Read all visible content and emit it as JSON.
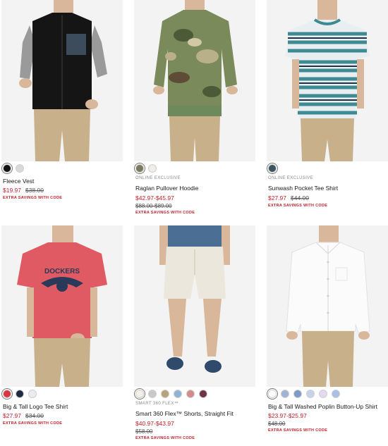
{
  "products": [
    {
      "name": "Fleece Vest",
      "tag": "",
      "sale_price": "$19.97",
      "original_price": "$38.00",
      "promo": "EXTRA SAVINGS WITH CODE",
      "swatches": [
        "#111111",
        "#d9d9d9"
      ]
    },
    {
      "name": "Raglan Pullover Hoodie",
      "tag": "ONLINE EXCLUSIVE",
      "sale_price": "$42.97-$45.97",
      "original_price": "$88.00-$89.00",
      "promo": "EXTRA SAVINGS WITH CODE",
      "swatches": [
        "#7c7a5c",
        "#f0ece6"
      ]
    },
    {
      "name": "Sunwash Pocket Tee Shirt",
      "tag": "ONLINE EXCLUSIVE",
      "sale_price": "$27.97",
      "original_price": "$44.00",
      "promo": "EXTRA SAVINGS WITH CODE",
      "swatches": [
        "#3b5560"
      ]
    },
    {
      "name": "Big & Tall Logo Tee Shirt",
      "tag": "",
      "sale_price": "$27.97",
      "original_price": "$34.00",
      "promo": "EXTRA SAVINGS WITH CODE",
      "swatches": [
        "#d9373d",
        "#1f2b45",
        "#e9edf2"
      ]
    },
    {
      "name": "Smart 360 Flex™ Shorts, Straight Fit",
      "tag": "SMART 360 FLEX™",
      "sale_price": "$40.97-$43.97",
      "original_price": "$58.00",
      "promo": "EXTRA SAVINGS WITH CODE",
      "swatches": [
        "#f5efe6",
        "#c9c9c9",
        "#b7a27c",
        "#8fb3d6",
        "#d38c8c",
        "#6e3344"
      ]
    },
    {
      "name": "Big & Tall Washed Poplin Button-Up Shirt",
      "tag": "",
      "sale_price": "$23.97-$25.97",
      "original_price": "$48.00",
      "promo": "EXTRA SAVINGS WITH CODE",
      "swatches": [
        "#ffffff",
        "#9fb3d4",
        "#7f99c9",
        "#c7d3ea",
        "#e4d9ee",
        "#a9bfe6"
      ]
    }
  ],
  "colors": {
    "sale_red": "#c0202b",
    "image_bg": "#f2f2f2",
    "khaki": "#c8b08a"
  }
}
